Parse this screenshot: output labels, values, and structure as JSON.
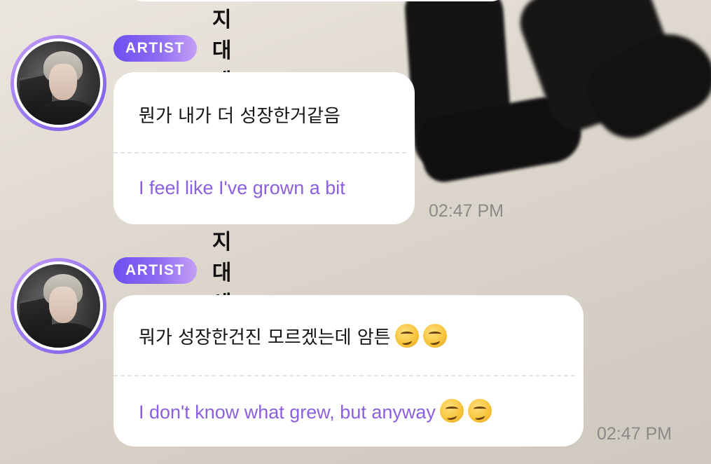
{
  "messages": [
    {
      "badge": "ARTIST",
      "sender": "지대세",
      "original": "뭔가 내가 더 성장한거같음",
      "translation": "I feel like I've grown a bit",
      "timestamp": "02:47 PM",
      "emojis": []
    },
    {
      "badge": "ARTIST",
      "sender": "지대세",
      "original": "뭐가 성장한건진 모르겠는데 암튼",
      "translation": "I don't know what grew, but anyway",
      "timestamp": "02:47 PM",
      "emojis": [
        "woozy-face-emoji",
        "woozy-face-emoji"
      ]
    }
  ],
  "colors": {
    "badge_gradient_start": "#6d4ff0",
    "badge_gradient_end": "#c4a0f7",
    "translation_text": "#8b5fe0",
    "timestamp_text": "#8a8a8a",
    "bubble_bg": "#ffffff"
  }
}
